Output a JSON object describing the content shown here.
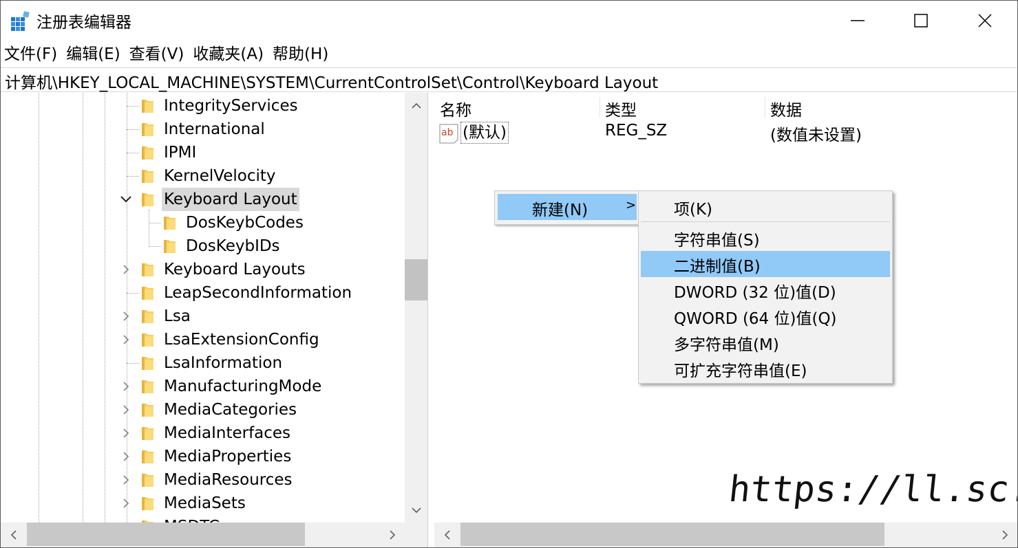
{
  "window": {
    "title": "注册表编辑器",
    "minimize_icon": "minimize-icon",
    "maximize_icon": "maximize-icon",
    "close_icon": "close-icon"
  },
  "menu": [
    "文件(F)",
    "编辑(E)",
    "查看(V)",
    "收藏夹(A)",
    "帮助(H)"
  ],
  "address": "计算机\\HKEY_LOCAL_MACHINE\\SYSTEM\\CurrentControlSet\\Control\\Keyboard Layout",
  "tree": [
    {
      "label": "IntegrityServices",
      "expander": "none"
    },
    {
      "label": "International",
      "expander": "none"
    },
    {
      "label": "IPMI",
      "expander": "none"
    },
    {
      "label": "KernelVelocity",
      "expander": "none"
    },
    {
      "label": "Keyboard Layout",
      "expander": "expanded",
      "selected": true
    },
    {
      "label": "DosKeybCodes",
      "expander": "none",
      "child": true
    },
    {
      "label": "DosKeybIDs",
      "expander": "none",
      "child": true
    },
    {
      "label": "Keyboard Layouts",
      "expander": "collapsed"
    },
    {
      "label": "LeapSecondInformation",
      "expander": "none"
    },
    {
      "label": "Lsa",
      "expander": "collapsed"
    },
    {
      "label": "LsaExtensionConfig",
      "expander": "collapsed"
    },
    {
      "label": "LsaInformation",
      "expander": "none"
    },
    {
      "label": "ManufacturingMode",
      "expander": "collapsed"
    },
    {
      "label": "MediaCategories",
      "expander": "collapsed"
    },
    {
      "label": "MediaInterfaces",
      "expander": "collapsed"
    },
    {
      "label": "MediaProperties",
      "expander": "collapsed"
    },
    {
      "label": "MediaResources",
      "expander": "collapsed"
    },
    {
      "label": "MediaSets",
      "expander": "collapsed"
    },
    {
      "label": "MSDTC",
      "expander": "collapsed"
    }
  ],
  "list": {
    "headers": {
      "name": "名称",
      "type": "类型",
      "data": "数据"
    },
    "rows": [
      {
        "icon": "string-value-icon",
        "name": "(默认)",
        "type": "REG_SZ",
        "data": "(数值未设置)"
      }
    ]
  },
  "context_menu": {
    "new_label": "新建(N)",
    "submenu_arrow": ">",
    "items": [
      "项(K)",
      "字符串值(S)",
      "二进制值(B)",
      "DWORD (32 位)值(D)",
      "QWORD (64 位)值(Q)",
      "多字符串值(M)",
      "可扩充字符串值(E)"
    ],
    "highlighted": "二进制值(B)"
  },
  "watermark": "https://ll.sc.cn",
  "colors": {
    "highlight": "#91c9f7",
    "selection": "#d9d9d9",
    "folder": "#f7cf5a"
  }
}
